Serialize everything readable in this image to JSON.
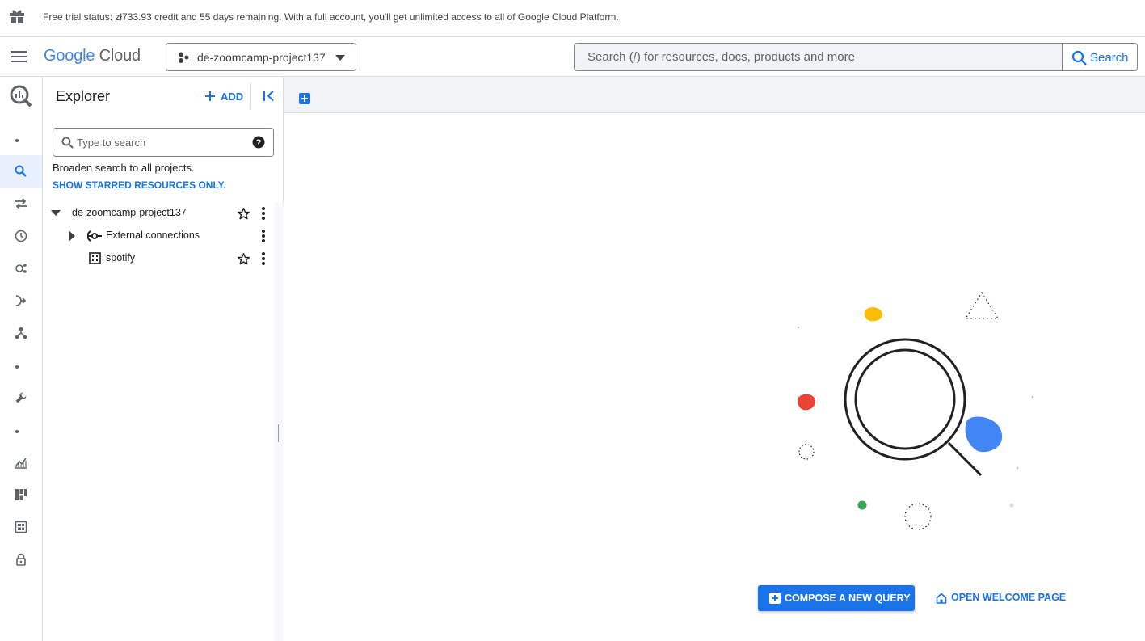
{
  "trial_banner": {
    "text": "Free trial status: zł733.93 credit and 55 days remaining. With a full account, you'll get unlimited access to all of Google Cloud Platform.",
    "icon": "gift-icon"
  },
  "header": {
    "logo_google": "Google",
    "logo_cloud": "Cloud",
    "project_name": "de-zoomcamp-project137",
    "search_placeholder": "Search (/) for resources, docs, products and more",
    "search_button_label": "Search"
  },
  "colors": {
    "accent": "#1a73e8",
    "google_blue": "#4285f4",
    "google_red": "#ea4335",
    "google_yellow": "#fbbc04",
    "google_green": "#34a853"
  },
  "rail": {
    "items": [
      "bigquery-logo-icon",
      "search-icon",
      "transfers-icon",
      "history-icon",
      "analytics-hub-icon",
      "pipelines-icon",
      "workflows-icon",
      "wrench-icon",
      "monitoring-icon",
      "dashboard-icon",
      "table-icon",
      "lock-icon"
    ]
  },
  "explorer": {
    "title": "Explorer",
    "add_label": "ADD",
    "search_placeholder": "Type to search",
    "broaden_text": "Broaden search to all projects.",
    "starred_link": "SHOW STARRED RESOURCES ONLY.",
    "tree": {
      "project": "de-zoomcamp-project137",
      "children": [
        {
          "label": "External connections"
        },
        {
          "label": "spotify"
        }
      ]
    }
  },
  "main": {
    "compose_label": "COMPOSE A NEW QUERY",
    "welcome_label": "OPEN WELCOME PAGE"
  }
}
